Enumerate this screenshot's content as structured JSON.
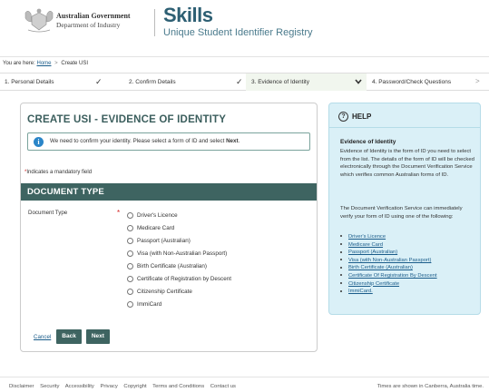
{
  "header": {
    "gov_line1": "Australian Government",
    "gov_line2": "Department of Industry",
    "brand": "Skills",
    "subtitle": "Unique Student Identifier Registry"
  },
  "breadcrumb": {
    "prefix": "You are here:",
    "home": "Home",
    "separator": ">",
    "current": "Create USI"
  },
  "steps": [
    {
      "label": "1.  Personal Details",
      "state": "done"
    },
    {
      "label": "2.  Confirm Details",
      "state": "done"
    },
    {
      "label": "3.  Evidence of Identity",
      "state": "active"
    },
    {
      "label": "4.  Password/Check Questions",
      "state": "pending"
    }
  ],
  "main": {
    "title": "CREATE USI - EVIDENCE OF IDENTITY",
    "info_text_a": "We need to confirm your identity. Please select a form of ID and select ",
    "info_text_b": "Next",
    "info_text_c": ".",
    "mandatory_note": "Indicates a mandatory field",
    "section_title": "DOCUMENT TYPE",
    "field_label": "Document Type",
    "options": [
      "Driver's Licence",
      "Medicare Card",
      "Passport (Australian)",
      "Visa (with Non-Australian Passport)",
      "Birth Certificate (Australian)",
      "Certificate of Registration by Descent",
      "Citizenship Certificate",
      "ImmiCard"
    ],
    "cancel": "Cancel",
    "back": "Back",
    "next": "Next"
  },
  "help": {
    "title": "HELP",
    "subtitle": "Evidence of Identity",
    "p1": "Evidence of Identity is the form of ID you need to select from the list. The details of the form of ID will be checked electronically through the Document Verification Service which verifies common Australian forms of ID.",
    "p2": "The Document Verification Service can immediately verify your form of ID using one of the following:",
    "links": [
      "Driver's Licence",
      "Medicare Card",
      "Passport (Australian)",
      "Visa (with Non-Australian Passport)",
      "Birth Certificate (Australian)",
      "Certificate Of Registration By Descent",
      "Citizenship Certificate",
      "ImmiCard."
    ]
  },
  "footer": {
    "links": [
      "Disclaimer",
      "Security",
      "Accessibility",
      "Privacy",
      "Copyright",
      "Terms and Conditions",
      "Contact us"
    ],
    "timezone_note": "Times are shown in Canberra, Australia time."
  },
  "colors": {
    "brand_teal": "#2d5f73",
    "section_bar": "#3e6461",
    "help_bg": "#daf0f7",
    "info_icon": "#2a85c8",
    "mandatory_star": "#d32020"
  }
}
